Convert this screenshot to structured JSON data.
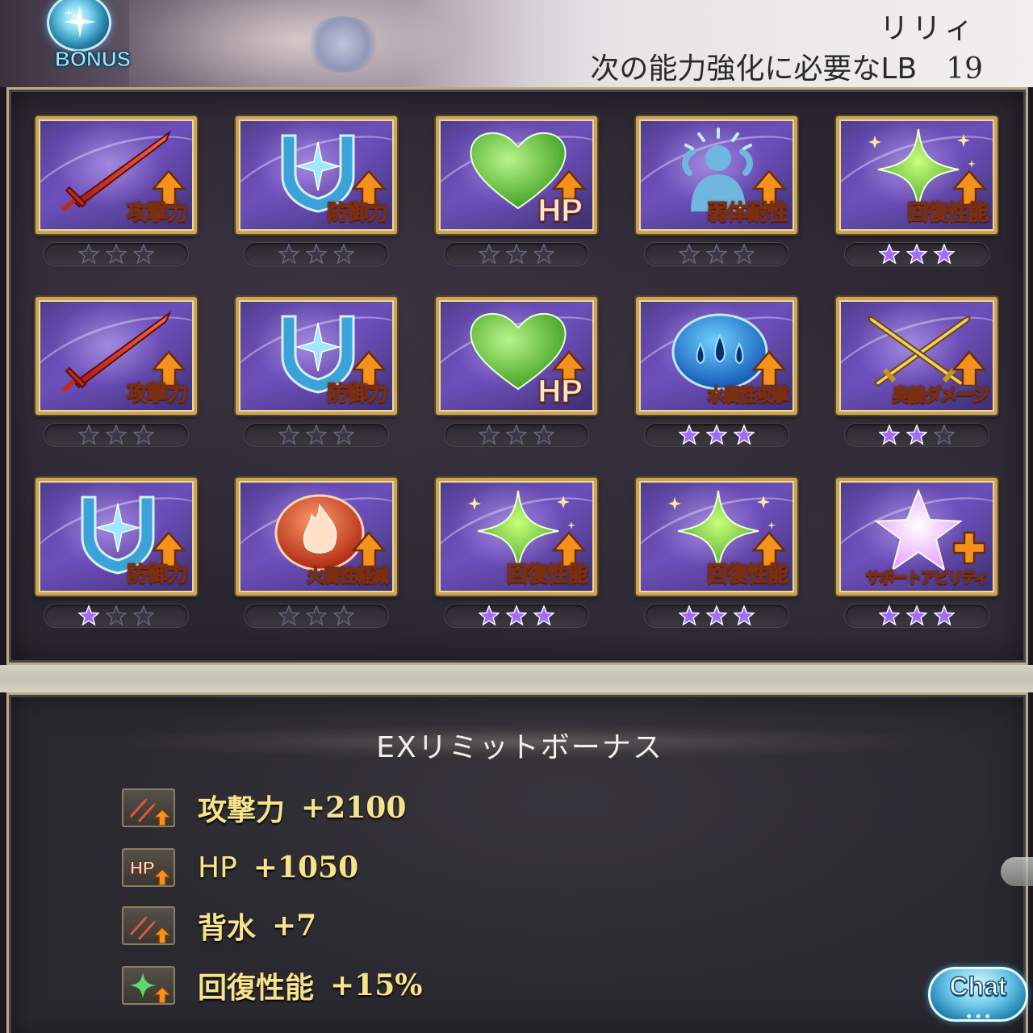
{
  "header": {
    "bonus_label": "BONUS",
    "character_name": "リリィ",
    "lb_required_label": "次の能力強化に必要なLB",
    "lb_required_value": "19"
  },
  "grid": [
    {
      "label": "攻撃力",
      "icon": "sword-icon",
      "stars": 0
    },
    {
      "label": "防御力",
      "icon": "shield-icon",
      "stars": 0
    },
    {
      "label": "HP",
      "icon": "heart-icon",
      "stars": 0
    },
    {
      "label": "弱体耐性",
      "icon": "debuff-resist-icon",
      "stars": 0
    },
    {
      "label": "回復性能",
      "icon": "sparkle-icon",
      "stars": 3
    },
    {
      "label": "攻撃力",
      "icon": "sword-icon",
      "stars": 0
    },
    {
      "label": "防御力",
      "icon": "shield-icon",
      "stars": 0
    },
    {
      "label": "HP",
      "icon": "heart-icon",
      "stars": 0
    },
    {
      "label": "水属性攻撃",
      "icon": "water-orb-icon",
      "stars": 3
    },
    {
      "label": "奥義ダメージ",
      "icon": "crossed-swords-icon",
      "stars": 2
    },
    {
      "label": "防御力",
      "icon": "shield-icon",
      "stars": 1
    },
    {
      "label": "火属性軽減",
      "icon": "fire-orb-icon",
      "stars": 0
    },
    {
      "label": "回復性能",
      "icon": "sparkle-icon",
      "stars": 3
    },
    {
      "label": "回復性能",
      "icon": "sparkle-icon",
      "stars": 3
    },
    {
      "label": "サポートアビリティ",
      "icon": "star-plus-icon",
      "stars": 3
    }
  ],
  "stars_max": 3,
  "ex_limit_bonus": {
    "title": "EXリミットボーナス",
    "items": [
      {
        "icon": "attack-up-icon",
        "label": "攻撃力",
        "value": "+2100"
      },
      {
        "icon": "hp-up-icon",
        "label": "HP",
        "value": "+1050"
      },
      {
        "icon": "enmity-up-icon",
        "label": "背水",
        "value": "+7"
      },
      {
        "icon": "heal-up-icon",
        "label": "回復性能",
        "value": "+15%"
      }
    ]
  },
  "chat_button_label": "Chat",
  "colors": {
    "tile_border": "#c8a55a",
    "star_active": "#a26cff",
    "star_inactive": "#3a3848",
    "bonus_text": "#f6e38a"
  }
}
